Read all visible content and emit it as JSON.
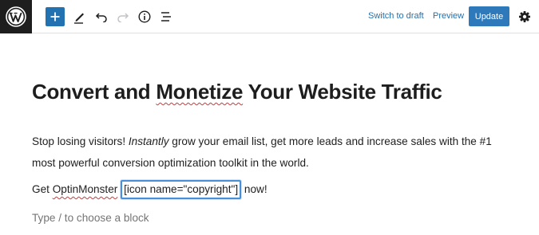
{
  "toolbar": {
    "switch_to_draft": "Switch to draft",
    "preview": "Preview",
    "update": "Update",
    "icons": [
      "wordpress-logo",
      "plus-icon",
      "pencil-icon",
      "undo-icon",
      "redo-icon",
      "info-icon",
      "list-view-icon",
      "settings-gear-icon"
    ],
    "accent_color": "#2271b1"
  },
  "content": {
    "title_part1": "Convert and ",
    "title_word2": "Monetize",
    "title_part3": " Your Website Traffic",
    "p1_start": "Stop losing visitors! ",
    "p1_italic": "Instantly",
    "p1_rest": " grow your email list, get more leads and increase sales with the #1 most powerful conversion optimization toolkit in the world.",
    "p2_start": "Get ",
    "p2_brand": "OptinMonster",
    "p2_shortcode": "[icon name=\"copyright\"]",
    "p2_end": " now!",
    "placeholder": "Type / to choose a block"
  }
}
